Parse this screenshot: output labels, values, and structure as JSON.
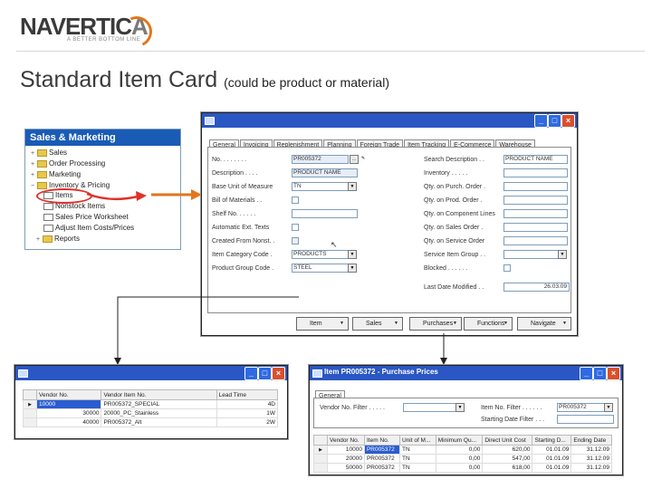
{
  "logo": {
    "text_main": "NAVERTIC",
    "text_accent": "A",
    "tagline": "A BETTER BOTTOM LINE"
  },
  "title": {
    "main": "Standard Item Card",
    "note": "(could be product or material)"
  },
  "colors": {
    "accent_red": "#e0302a",
    "accent_orange": "#e2761b",
    "titlebar_blue": "#2a57c4",
    "nav_header_blue": "#1a5bb5"
  },
  "nav": {
    "header": "Sales & Marketing",
    "items": [
      {
        "label": "Sales",
        "marker": "+"
      },
      {
        "label": "Order Processing",
        "marker": "+"
      },
      {
        "label": "Marketing",
        "marker": "+"
      },
      {
        "label": "Inventory & Pricing",
        "marker": "−"
      },
      {
        "label": "Items",
        "marker": ""
      },
      {
        "label": "Nonstock Items",
        "marker": ""
      },
      {
        "label": "Sales Price Worksheet",
        "marker": ""
      },
      {
        "label": "Adjust Item Costs/Prices",
        "marker": ""
      },
      {
        "label": "Reports",
        "marker": "+"
      }
    ]
  },
  "item_card": {
    "tabs": [
      "General",
      "Invoicing",
      "Replenishment",
      "Planning",
      "Foreign Trade",
      "Item Tracking",
      "E-Commerce",
      "Warehouse"
    ],
    "left_fields": [
      {
        "label": "No. . . . . . . .",
        "value": "PR005372"
      },
      {
        "label": "Description . . . .",
        "value": "PRODUCT NAME"
      },
      {
        "label": "Base Unit of Measure",
        "value": "TN"
      },
      {
        "label": "Bill of Materials . .",
        "value": ""
      },
      {
        "label": "Shelf No. . . . . .",
        "value": ""
      },
      {
        "label": "Automatic Ext. Texts",
        "value": ""
      },
      {
        "label": "Created From Nonst. .",
        "value": ""
      },
      {
        "label": "Item Category Code .",
        "value": "PRODUCTS"
      },
      {
        "label": "Product Group Code .",
        "value": "STEEL"
      }
    ],
    "right_fields": [
      {
        "label": "Search Description . .",
        "value": "PRODUCT NAME"
      },
      {
        "label": "Inventory . . . . .",
        "value": ""
      },
      {
        "label": "Qty. on Purch. Order .",
        "value": ""
      },
      {
        "label": "Qty. on Prod. Order .",
        "value": ""
      },
      {
        "label": "Qty. on Component Lines",
        "value": ""
      },
      {
        "label": "Qty. on Sales Order .",
        "value": ""
      },
      {
        "label": "Qty. on Service Order",
        "value": ""
      },
      {
        "label": "Service Item Group . .",
        "value": ""
      },
      {
        "label": "Blocked . . . . . .",
        "value": ""
      },
      {
        "label": "Last Date Modified . .",
        "value": "26.03.09"
      }
    ],
    "buttons": [
      "Item",
      "Sales",
      "Purchases",
      "Functions",
      "Navigate"
    ]
  },
  "vendor_window": {
    "columns": [
      "Vendor No.",
      "Vendor Item No.",
      "Lead Time"
    ],
    "rows": [
      {
        "vendor_no": "10000",
        "item_no": "PR005372_SPECIAL",
        "lead": "4D"
      },
      {
        "vendor_no": "30000",
        "item_no": "20000_PC_Stainless",
        "lead": "1W"
      },
      {
        "vendor_no": "40000",
        "item_no": "PR005372_Alt",
        "lead": "2W"
      }
    ]
  },
  "prices_window": {
    "title": "Item PR005372 - Purchase Prices",
    "tab": "General",
    "vendor_filter_label": "Vendor No. Filter . . . . .",
    "vendor_filter_value": "",
    "item_filter_label": "Item No. Filter . . . . . .",
    "item_filter_value": "PR005372",
    "date_filter_label": "Starting Date Filter . . .",
    "date_filter_value": "",
    "columns": [
      "Vendor No.",
      "Item No.",
      "Unit of M...",
      "Minimum Qu...",
      "Direct Unit Cost",
      "Starting D...",
      "Ending Date"
    ],
    "rows": [
      [
        "10000",
        "PR005372",
        "TN",
        "0,00",
        "620,00",
        "01.01.09",
        "31.12.09"
      ],
      [
        "20000",
        "PR005372",
        "TN",
        "0,00",
        "547,00",
        "01.01.09",
        "31.12.09"
      ],
      [
        "50000",
        "PR005372",
        "TN",
        "0,00",
        "618,00",
        "01.01.09",
        "31.12.09"
      ]
    ]
  }
}
